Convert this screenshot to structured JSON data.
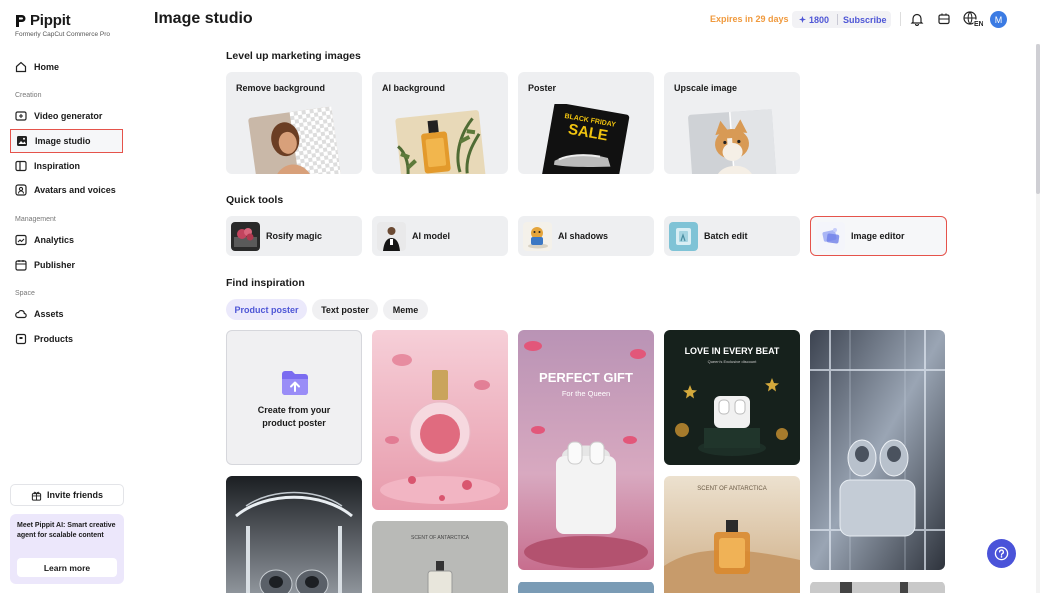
{
  "brand": {
    "name": "Pippit",
    "tagline": "Formerly CapCut Commerce Pro"
  },
  "sidebar": {
    "home": "Home",
    "sections": {
      "creation": "Creation",
      "management": "Management",
      "space": "Space"
    },
    "creation_items": [
      {
        "label": "Video generator",
        "icon": "video-generator-icon"
      },
      {
        "label": "Image studio",
        "icon": "image-studio-icon",
        "active": true
      },
      {
        "label": "Inspiration",
        "icon": "inspiration-icon"
      },
      {
        "label": "Avatars and voices",
        "icon": "avatar-icon"
      }
    ],
    "management_items": [
      {
        "label": "Analytics",
        "icon": "analytics-icon"
      },
      {
        "label": "Publisher",
        "icon": "calendar-icon"
      }
    ],
    "space_items": [
      {
        "label": "Assets",
        "icon": "cloud-icon"
      },
      {
        "label": "Products",
        "icon": "box-icon"
      }
    ],
    "invite_label": "Invite friends",
    "promo": {
      "text": "Meet Pippit AI: Smart creative agent for scalable content",
      "button": "Learn more"
    }
  },
  "header": {
    "title": "Image studio",
    "expires": "Expires in 29 days",
    "credits": "1800",
    "subscribe": "Subscribe",
    "language_badge": "EN",
    "avatar_initial": "M"
  },
  "marketing": {
    "title": "Level up marketing images",
    "cards": [
      {
        "label": "Remove background"
      },
      {
        "label": "AI background"
      },
      {
        "label": "Poster"
      },
      {
        "label": "Upscale image"
      }
    ],
    "poster_art": {
      "line1": "BLACK FRIDAY",
      "line2": "SALE"
    }
  },
  "quick_tools": {
    "title": "Quick tools",
    "items": [
      {
        "label": "Rosify magic"
      },
      {
        "label": "AI model"
      },
      {
        "label": "AI shadows"
      },
      {
        "label": "Batch edit"
      },
      {
        "label": "Image editor",
        "active": true
      }
    ]
  },
  "inspiration": {
    "title": "Find inspiration",
    "tabs": [
      {
        "label": "Product poster",
        "active": true
      },
      {
        "label": "Text poster"
      },
      {
        "label": "Meme"
      }
    ],
    "create_tile": "Create from your product poster",
    "tile_texts": {
      "perfect_gift": "PERFECT GIFT",
      "for_queen": "For the Queen",
      "love_beat": "LOVE IN EVERY BEAT",
      "love_sub": "Queen's Exclusive discount",
      "scent": "SCENT OF ANTARCTICA",
      "scent2": "SCENT OF ANTARCTICA"
    }
  },
  "colors": {
    "accent": "#4e56d6",
    "highlight_border": "#e5534b",
    "expires": "#f09a3e"
  }
}
